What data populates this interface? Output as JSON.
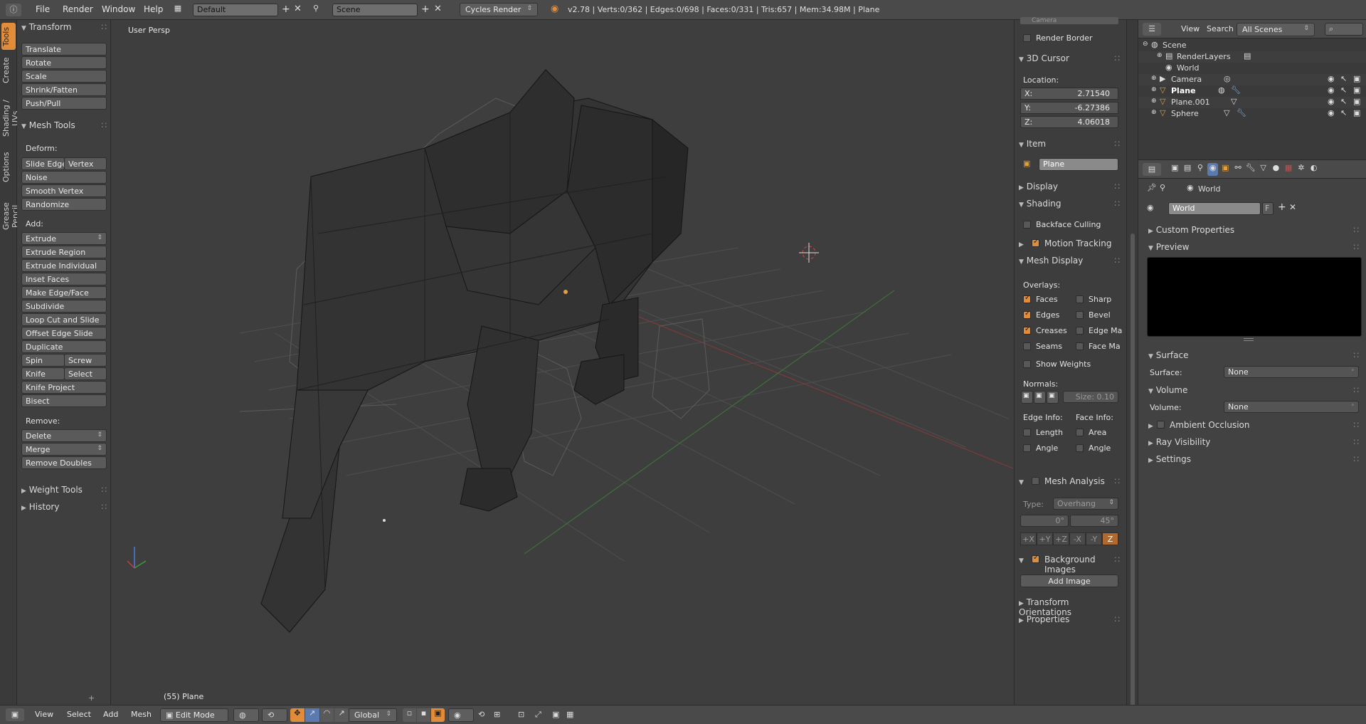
{
  "topbar": {
    "info_icon": "info-icon",
    "menus": [
      "File",
      "Render",
      "Window",
      "Help"
    ],
    "screen_layout": "Default",
    "scene": "Scene",
    "render_engine": "Cycles Render",
    "stats": "v2.78 | Verts:0/362 | Edges:0/698 | Faces:0/331 | Tris:657 | Mem:34.98M | Plane"
  },
  "tabs": [
    "Tools",
    "Create",
    "Shading / UVs",
    "Options",
    "Grease Pencil"
  ],
  "toolshelf": {
    "transform_title": "Transform",
    "transform_buttons": [
      "Translate",
      "Rotate",
      "Scale",
      "Shrink/Fatten",
      "Push/Pull"
    ],
    "mesh_tools_title": "Mesh Tools",
    "deform_label": "Deform:",
    "slide_edge": "Slide Edge",
    "vertex": "Vertex",
    "noise": "Noise",
    "smooth_vertex": "Smooth Vertex",
    "randomize": "Randomize",
    "add_label": "Add:",
    "extrude": "Extrude",
    "extrude_region": "Extrude Region",
    "extrude_individual": "Extrude Individual",
    "inset_faces": "Inset Faces",
    "make_edge_face": "Make Edge/Face",
    "subdivide": "Subdivide",
    "loop_cut": "Loop Cut and Slide",
    "offset_edge_slide": "Offset Edge Slide",
    "duplicate": "Duplicate",
    "spin": "Spin",
    "screw": "Screw",
    "knife": "Knife",
    "select": "Select",
    "knife_project": "Knife Project",
    "bisect": "Bisect",
    "remove_label": "Remove:",
    "delete": "Delete",
    "merge": "Merge",
    "remove_doubles": "Remove Doubles",
    "weight_tools_title": "Weight Tools",
    "history_title": "History"
  },
  "viewport": {
    "view_label": "User Persp",
    "object_label": "(55) Plane"
  },
  "npanel": {
    "camera_partial": "Camera",
    "render_border": "Render Border",
    "cursor_title": "3D Cursor",
    "location_label": "Location:",
    "x_label": "X:",
    "x_value": "2.71540",
    "y_label": "Y:",
    "y_value": "-6.27386",
    "z_label": "Z:",
    "z_value": "4.06018",
    "item_title": "Item",
    "item_name": "Plane",
    "display_title": "Display",
    "shading_title": "Shading",
    "backface_culling": "Backface Culling",
    "motion_tracking": "Motion Tracking",
    "mesh_display_title": "Mesh Display",
    "overlays_label": "Overlays:",
    "faces": "Faces",
    "sharp": "Sharp",
    "edges": "Edges",
    "bevel": "Bevel",
    "creases": "Creases",
    "edge_ma": "Edge Ma",
    "seams": "Seams",
    "face_ma": "Face Ma",
    "show_weights": "Show Weights",
    "normals_label": "Normals:",
    "size_value": "Size:  0.10",
    "edge_info": "Edge Info:",
    "face_info": "Face Info:",
    "length": "Length",
    "area": "Area",
    "angle1": "Angle",
    "angle2": "Angle",
    "mesh_analysis": "Mesh Analysis",
    "type_label": "Type:",
    "type_value": "Overhang",
    "deg0": "0°",
    "deg45": "45°",
    "axes": [
      "+X",
      "+Y",
      "+Z",
      "-X",
      "-Y",
      "Z"
    ],
    "background_images": "Background Images",
    "add_image": "Add Image",
    "transform_orientations": "Transform Orientations",
    "properties": "Properties"
  },
  "outliner": {
    "view": "View",
    "search": "Search",
    "scenes_filter": "All Scenes",
    "items": [
      {
        "name": "Scene"
      },
      {
        "name": "RenderLayers"
      },
      {
        "name": "World"
      },
      {
        "name": "Camera"
      },
      {
        "name": "Plane"
      },
      {
        "name": "Plane.001"
      },
      {
        "name": "Sphere"
      }
    ]
  },
  "properties": {
    "breadcrumb": "World",
    "world_name": "World",
    "fake_user": "F",
    "custom_properties": "Custom Properties",
    "preview": "Preview",
    "surface_title": "Surface",
    "surface_label": "Surface:",
    "surface_value": "None",
    "volume_title": "Volume",
    "volume_label": "Volume:",
    "volume_value": "None",
    "ambient_occlusion": "Ambient Occlusion",
    "ray_visibility": "Ray Visibility",
    "settings": "Settings"
  },
  "bottombar": {
    "menus": [
      "View",
      "Select",
      "Add",
      "Mesh"
    ],
    "mode": "Edit Mode",
    "orientation": "Global"
  },
  "colors": {
    "accent": "#e08c3a",
    "selected_field": "#8a8a8a",
    "grid_x": "#a03030",
    "grid_y": "#3a8a3a"
  }
}
